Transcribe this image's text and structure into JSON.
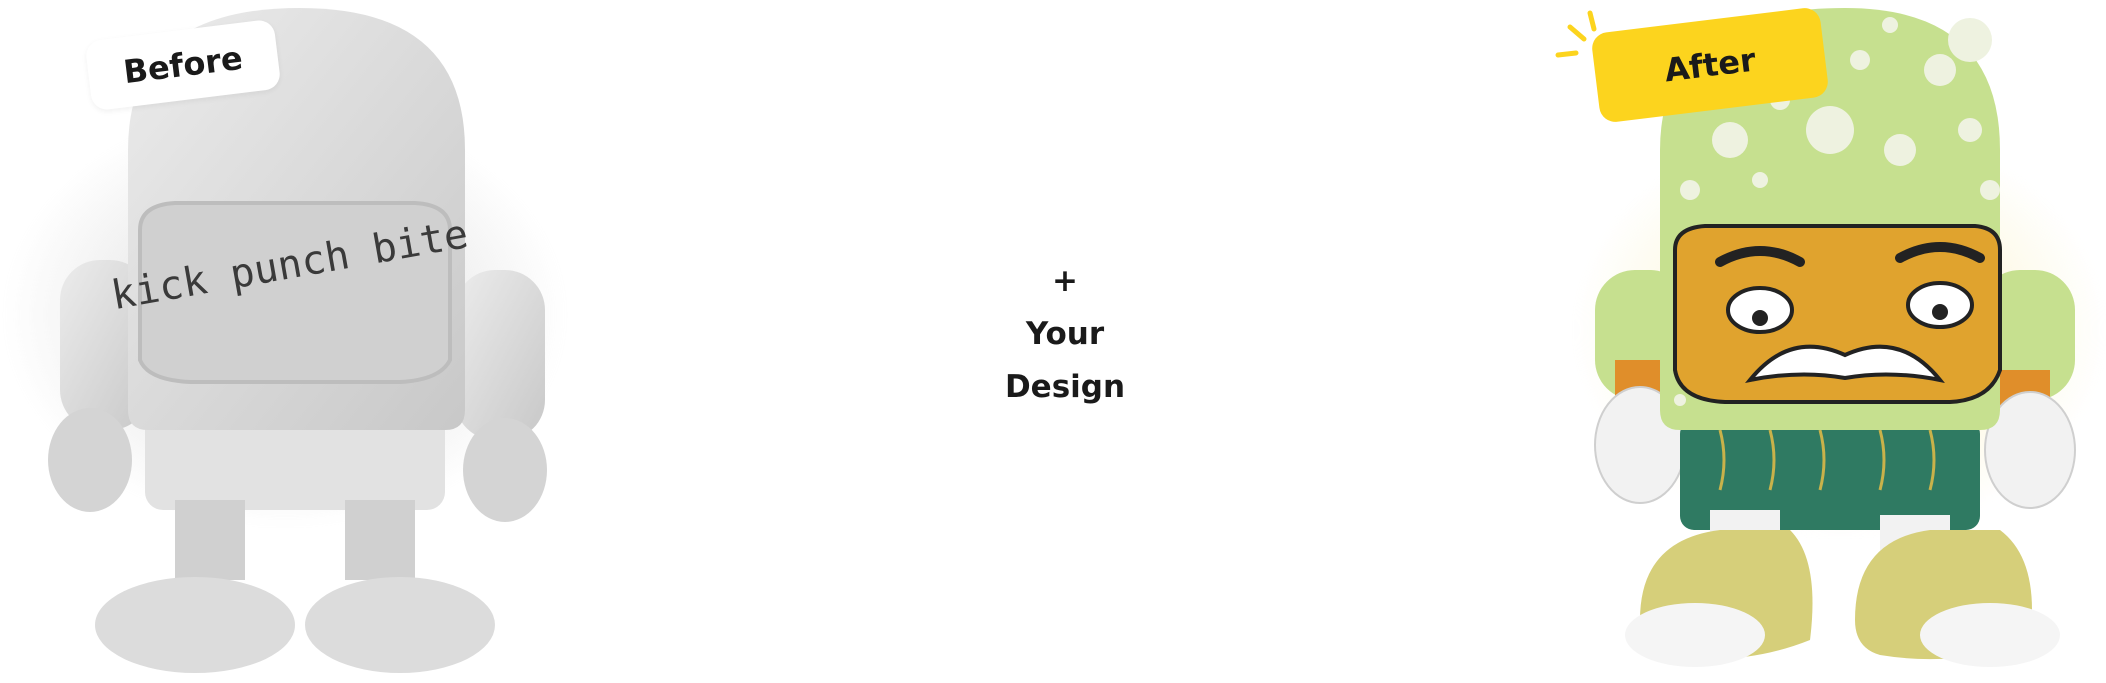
{
  "labels": {
    "before": "Before",
    "after": "After"
  },
  "center": {
    "plus": "+",
    "line1": "Your",
    "line2": "Design"
  },
  "figure_before": {
    "logo_text": "kick punch bite",
    "color": "#dcdcdc"
  },
  "colors": {
    "after_tag": "#fcd41e",
    "helmet": "#c6e08f",
    "shorts": "#2f7a62",
    "face": "#e0a32e"
  }
}
